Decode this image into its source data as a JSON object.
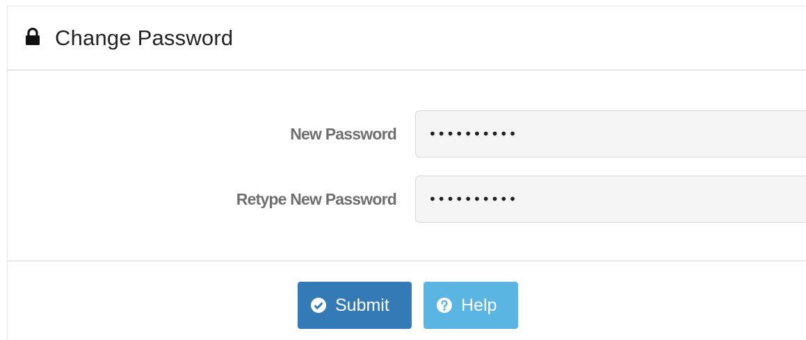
{
  "header": {
    "title": "Change Password",
    "icon": "lock-icon"
  },
  "form": {
    "new_password": {
      "label": "New Password",
      "value": "••••••••••"
    },
    "retype_password": {
      "label": "Retype New Password",
      "value": "••••••••••"
    }
  },
  "actions": {
    "submit_label": "Submit",
    "submit_icon": "check-circle-icon",
    "help_label": "Help",
    "help_icon": "question-circle-icon"
  },
  "colors": {
    "submit_bg": "#337ab7",
    "help_bg": "#5bb5e3",
    "label_text": "#6f6f6f"
  }
}
